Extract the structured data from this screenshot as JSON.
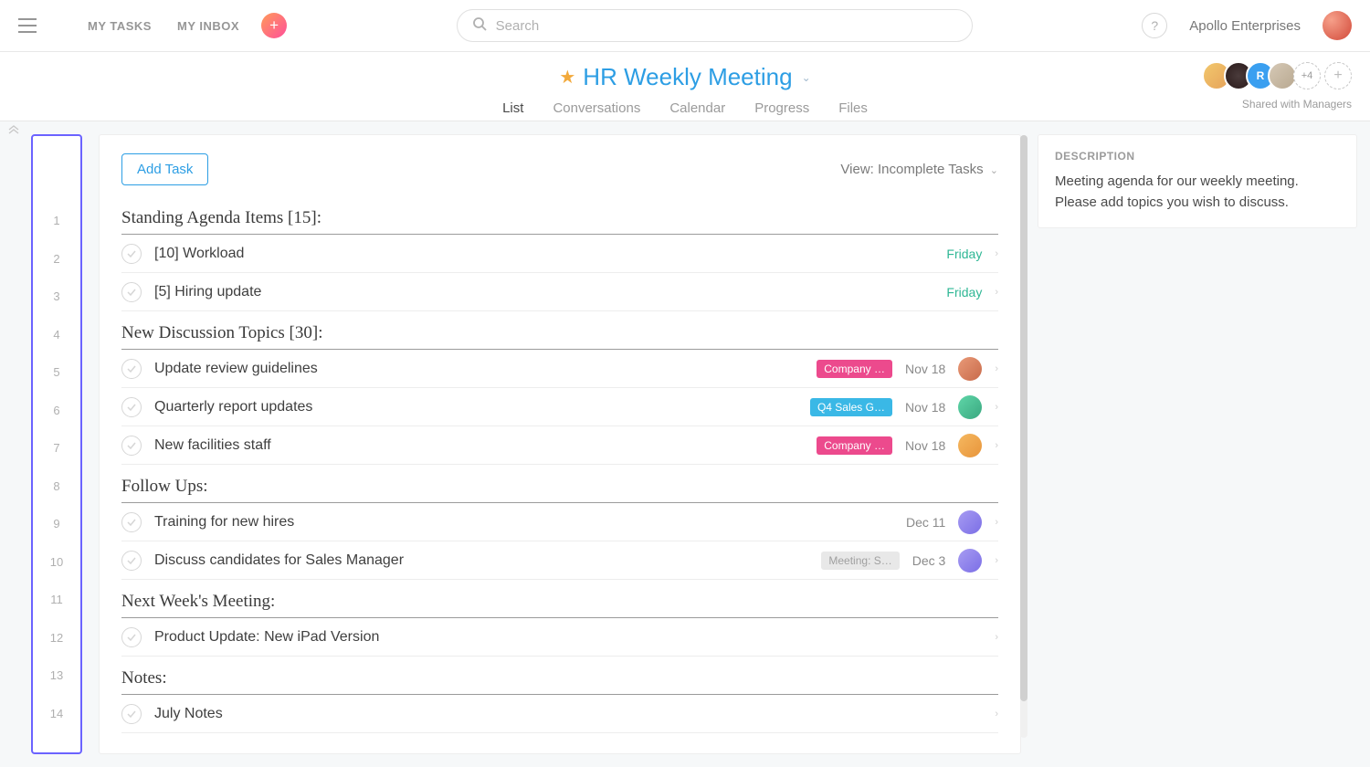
{
  "topbar": {
    "my_tasks": "MY TASKS",
    "my_inbox": "MY INBOX",
    "search_placeholder": "Search",
    "help": "?",
    "org_name": "Apollo Enterprises"
  },
  "project": {
    "title": "HR Weekly Meeting",
    "tabs": [
      "List",
      "Conversations",
      "Calendar",
      "Progress",
      "Files"
    ],
    "active_tab": "List",
    "members_more": "+4",
    "shared_with": "Shared with Managers"
  },
  "members_initial_3": "R",
  "toolbar": {
    "add_task": "Add Task",
    "view_label": "View: Incomplete Tasks"
  },
  "line_numbers": [
    "1",
    "2",
    "3",
    "4",
    "5",
    "6",
    "7",
    "8",
    "9",
    "10",
    "11",
    "12",
    "13",
    "14"
  ],
  "sections": [
    {
      "title": "Standing Agenda Items [15]:",
      "tasks": [
        {
          "title": "[10] Workload",
          "due": "Friday",
          "due_style": "green"
        },
        {
          "title": "[5] Hiring update",
          "due": "Friday",
          "due_style": "green"
        }
      ]
    },
    {
      "title": "New Discussion Topics [30]:",
      "tasks": [
        {
          "title": "Update review guidelines",
          "tag": "Company …",
          "tag_style": "pink",
          "due": "Nov 18",
          "due_style": "gray",
          "assignee": "p1"
        },
        {
          "title": "Quarterly report updates",
          "tag": "Q4 Sales G…",
          "tag_style": "blue",
          "due": "Nov 18",
          "due_style": "gray",
          "assignee": "p2"
        },
        {
          "title": "New facilities staff",
          "tag": "Company …",
          "tag_style": "pink",
          "due": "Nov 18",
          "due_style": "gray",
          "assignee": "p3"
        }
      ]
    },
    {
      "title": "Follow Ups:",
      "tasks": [
        {
          "title": "Training for new hires",
          "due": "Dec 11",
          "due_style": "gray",
          "assignee": "p4"
        },
        {
          "title": "Discuss candidates for Sales Manager",
          "tag": "Meeting: S…",
          "tag_style": "subtle",
          "due": "Dec 3",
          "due_style": "gray",
          "assignee": "p4"
        }
      ]
    },
    {
      "title": "Next Week's Meeting:",
      "tasks": [
        {
          "title": "Product Update: New iPad Version"
        }
      ]
    },
    {
      "title": "Notes:",
      "tasks": [
        {
          "title": "July Notes"
        }
      ]
    }
  ],
  "description": {
    "label": "DESCRIPTION",
    "text": "Meeting agenda for our weekly meeting. Please add topics you wish to discuss."
  }
}
